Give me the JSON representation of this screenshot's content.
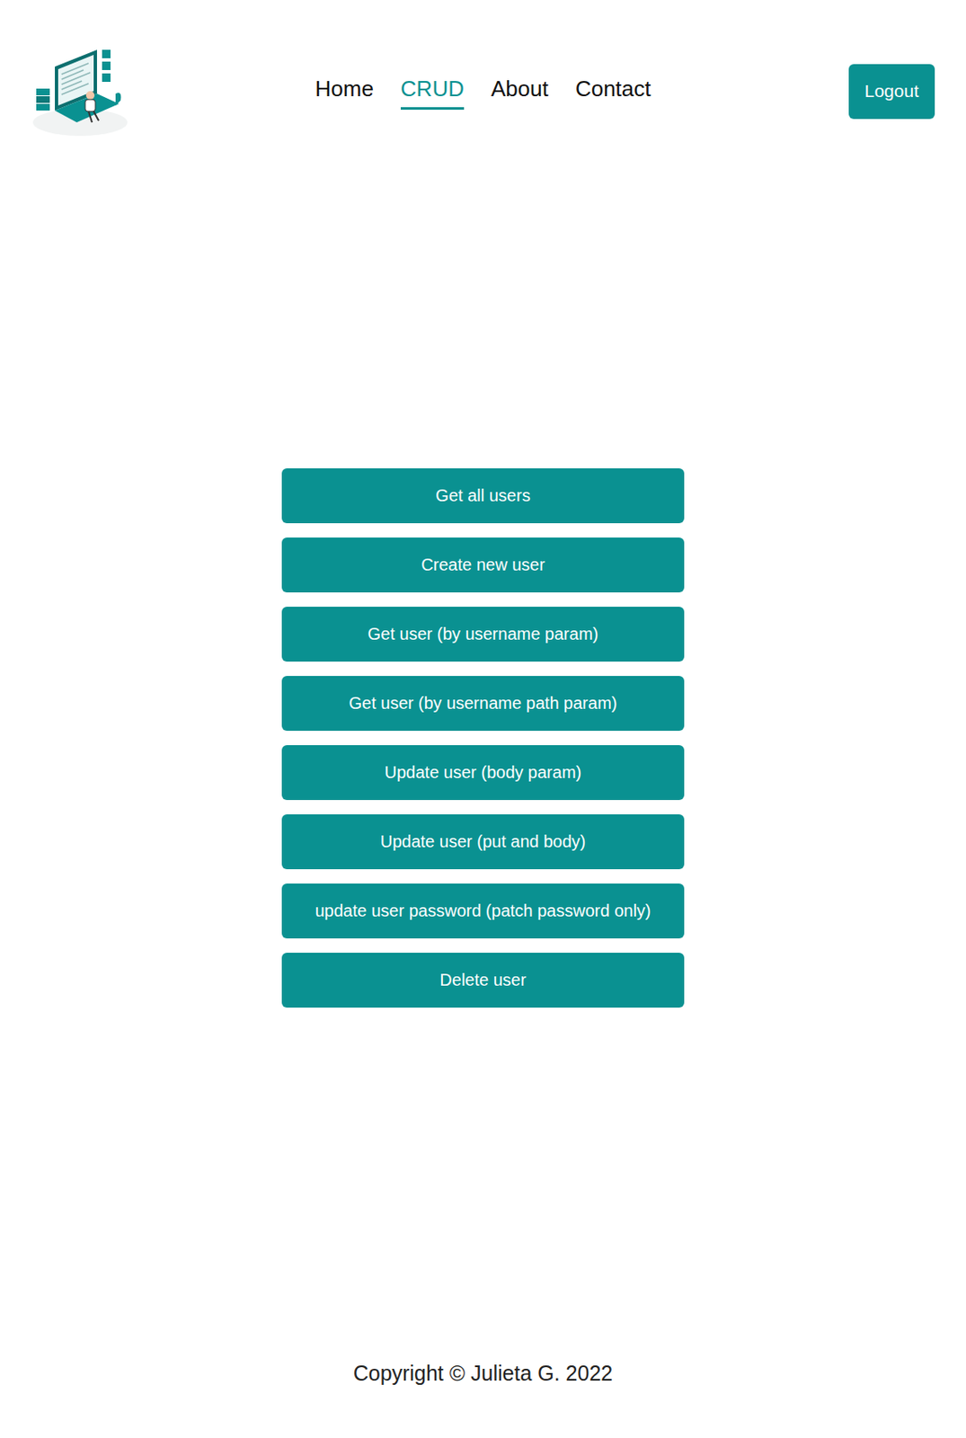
{
  "header": {
    "nav": [
      {
        "label": "Home",
        "selected": false
      },
      {
        "label": "CRUD",
        "selected": true
      },
      {
        "label": "About",
        "selected": false
      },
      {
        "label": "Contact",
        "selected": false
      }
    ],
    "logout_button": "Logout"
  },
  "actions": [
    "Get all users",
    "Create new user",
    "Get user (by username param)",
    "Get user (by username path param)",
    "Update user (body param)",
    "Update user (put and body)",
    "update user password (patch password only)",
    "Delete user"
  ],
  "footer": {
    "copyright": "Copyright © Julieta G. 2022"
  }
}
